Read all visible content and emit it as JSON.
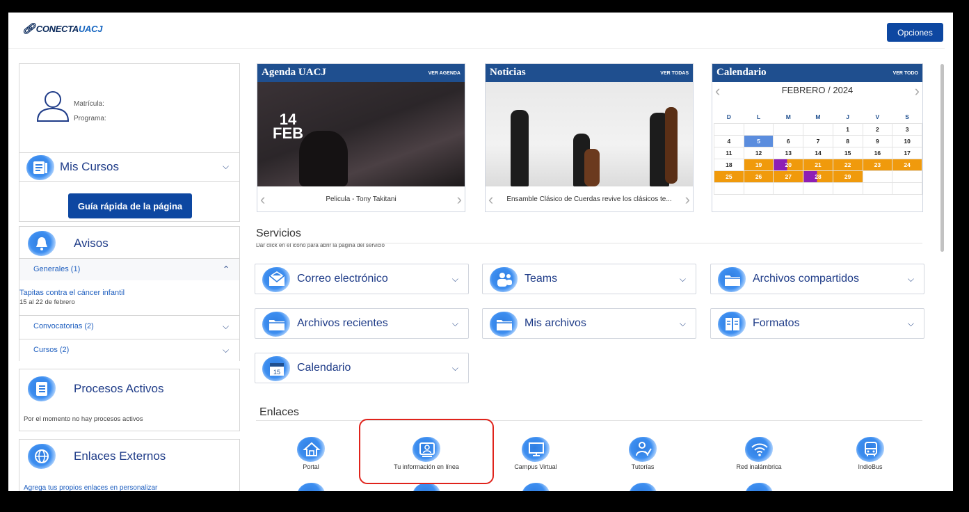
{
  "header": {
    "logo_prefix": "CONECTA",
    "logo_suffix": "UACJ",
    "options_label": "Opciones"
  },
  "profile": {
    "matricula_label": "Matrícula:",
    "programa_label": "Programa:",
    "mis_cursos": "Mis Cursos",
    "guide_button": "Guía rápida de la página"
  },
  "avisos": {
    "title": "Avisos",
    "generales": "Generales (1)",
    "item_title": "Tapitas contra el cáncer infantil",
    "item_date": "15 al 22 de febrero",
    "convocatorias": "Convocatorias (2)",
    "cursos": "Cursos (2)"
  },
  "procesos": {
    "title": "Procesos Activos",
    "message": "Por el momento no hay procesos activos"
  },
  "enlaces_externos": {
    "title": "Enlaces Externos",
    "message": "Agrega tus propios enlaces en personalizar"
  },
  "agenda": {
    "title": "Agenda UACJ",
    "link": "VER AGENDA",
    "caption": "Pelicula - Tony Takitani",
    "poster_date_day": "14",
    "poster_date_month": "FEB"
  },
  "noticias": {
    "title": "Noticias",
    "link": "VER TODAS",
    "caption": "Ensamble Clásico de Cuerdas revive los clásicos te..."
  },
  "calendario": {
    "title": "Calendario",
    "link": "VER TODO",
    "month": "FEBRERO / 2024",
    "weekdays": [
      "D",
      "L",
      "M",
      "M",
      "J",
      "V",
      "S"
    ],
    "weeks": [
      [
        "",
        "",
        "",
        "",
        "1",
        "2",
        "3"
      ],
      [
        "4",
        "5",
        "6",
        "7",
        "8",
        "9",
        "10"
      ],
      [
        "11",
        "12",
        "13",
        "14",
        "15",
        "16",
        "17"
      ],
      [
        "18",
        "19",
        "20",
        "21",
        "22",
        "23",
        "24"
      ],
      [
        "25",
        "26",
        "27",
        "28",
        "29",
        "",
        ""
      ],
      [
        "",
        "",
        "",
        "",
        "",
        "",
        ""
      ]
    ],
    "colors": {
      "event": "#f09a0c",
      "today": "#5b8dde",
      "marker": "#8e1fb4"
    }
  },
  "servicios": {
    "title": "Servicios",
    "subtitle": "Dar click en el icono para abrir la página del servicio",
    "items": [
      {
        "label": "Correo electrónico",
        "icon": "envelope-icon"
      },
      {
        "label": "Teams",
        "icon": "teams-icon"
      },
      {
        "label": "Archivos compartidos",
        "icon": "folder-icon"
      },
      {
        "label": "Archivos recientes",
        "icon": "folder-icon"
      },
      {
        "label": "Mis archivos",
        "icon": "folder-icon"
      },
      {
        "label": "Formatos",
        "icon": "document-icon"
      },
      {
        "label": "Calendario",
        "icon": "calendar-icon"
      }
    ],
    "calendar_icon_day": "15"
  },
  "enlaces": {
    "title": "Enlaces",
    "items": [
      {
        "label": "Portal",
        "icon": "home-icon"
      },
      {
        "label": "Tu información en línea",
        "icon": "id-card-icon"
      },
      {
        "label": "Campus Virtual",
        "icon": "monitor-icon"
      },
      {
        "label": "Tutorías",
        "icon": "tutor-icon"
      },
      {
        "label": "Red inalámbrica",
        "icon": "wifi-icon"
      },
      {
        "label": "IndioBus",
        "icon": "bus-icon"
      }
    ]
  },
  "colors": {
    "primary": "#0d47a1",
    "widget_header": "#1f4f8f",
    "link": "#1f5fbf",
    "highlight": "#e0231b"
  }
}
